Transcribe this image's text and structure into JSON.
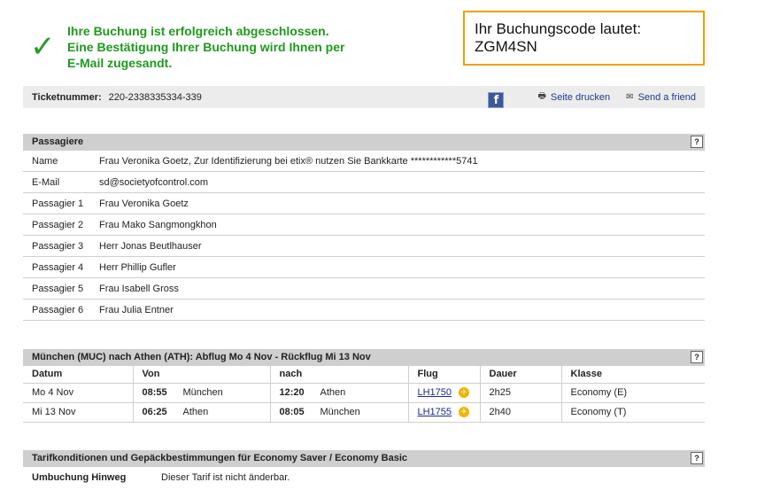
{
  "confirmation": {
    "icon": "checkmark-icon",
    "line1": "Ihre Buchung ist erfolgreich abgeschlossen.",
    "line2": "Eine Bestätigung Ihrer Buchung wird Ihnen per",
    "line3": "E-Mail zugesandt."
  },
  "booking_code": {
    "label": "Ihr Buchungscode lautet:",
    "code": "ZGM4SN"
  },
  "ticket_bar": {
    "label": "Ticketnummer:",
    "number": "220-2338335334-339",
    "facebook_glyph": "f",
    "print_label": "Seite drucken",
    "send_label": "Send a friend"
  },
  "passengers": {
    "title": "Passagiere",
    "help": "?",
    "rows": [
      {
        "key": "Name",
        "value": "Frau  Veronika Goetz, Zur Identifizierung bei etix® nutzen Sie Bankkarte ************5741"
      },
      {
        "key": "E-Mail",
        "value": "sd@societyofcontrol.com"
      },
      {
        "key": "Passagier 1",
        "value": "Frau Veronika Goetz"
      },
      {
        "key": "Passagier 2",
        "value": "Frau Mako Sangmongkhon"
      },
      {
        "key": "Passagier 3",
        "value": "Herr Jonas Beutlhauser"
      },
      {
        "key": "Passagier 4",
        "value": "Herr Phillip Gufler"
      },
      {
        "key": "Passagier 5",
        "value": "Frau Isabell Gross"
      },
      {
        "key": "Passagier 6",
        "value": "Frau Julia Entner"
      }
    ]
  },
  "flights": {
    "title": "München (MUC)  nach  Athen (ATH):  Abflug  Mo 4 Nov -  Rückflug  Mi 13 Nov",
    "help": "?",
    "headers": [
      "Datum",
      "Von",
      "nach",
      "Flug",
      "Dauer",
      "Klasse"
    ],
    "rows": [
      {
        "date": "Mo 4 Nov",
        "dep_time": "08:55",
        "dep_city": "München",
        "arr_time": "12:20",
        "arr_city": "Athen",
        "flight": "LH1750",
        "duration": "2h25",
        "class": "Economy  (E)"
      },
      {
        "date": "Mi 13 Nov",
        "dep_time": "06:25",
        "dep_city": "Athen",
        "arr_time": "08:05",
        "arr_city": "München",
        "flight": "LH1755",
        "duration": "2h40",
        "class": "Economy  (T)"
      }
    ]
  },
  "tariff": {
    "title": "Tarifkonditionen und Gepäckbestimmungen für  Economy Saver / Economy Basic",
    "help": "?",
    "row_key": "Umbuchung Hinweg",
    "row_value": "Dieser Tarif ist nicht änderbar."
  }
}
